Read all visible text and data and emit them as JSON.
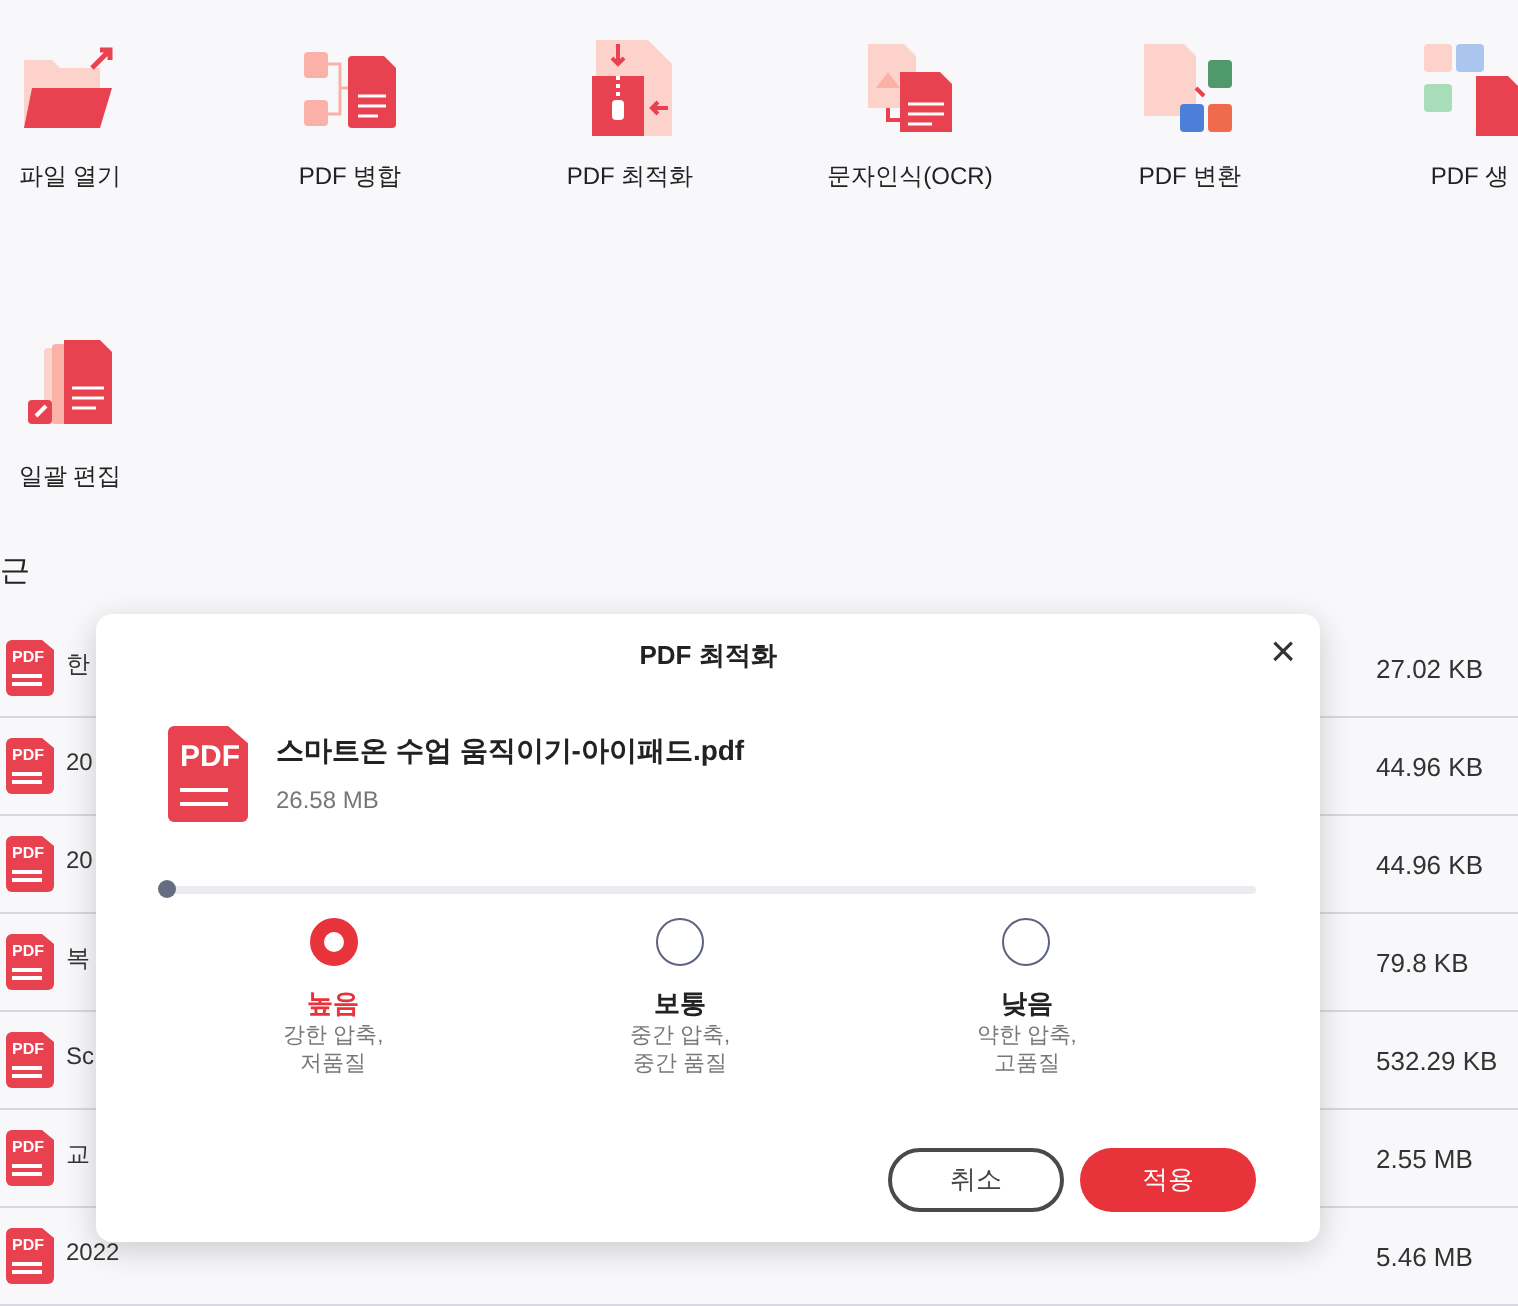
{
  "tools": [
    {
      "label": "파일 열기",
      "kind": "open"
    },
    {
      "label": "PDF 병합",
      "kind": "merge"
    },
    {
      "label": "PDF 최적화",
      "kind": "compress"
    },
    {
      "label": "문자인식(OCR)",
      "kind": "ocr"
    },
    {
      "label": "PDF 변환",
      "kind": "convert"
    },
    {
      "label": "PDF 생",
      "kind": "create"
    },
    {
      "label": "일괄 편집",
      "kind": "batch"
    }
  ],
  "section": {
    "title": "근"
  },
  "files": [
    {
      "icon_label": "PDF",
      "name": "한",
      "size": "27.02 KB"
    },
    {
      "icon_label": "PDF",
      "name": "20",
      "size": "44.96 KB"
    },
    {
      "icon_label": "PDF",
      "name": "20",
      "size": "44.96 KB"
    },
    {
      "icon_label": "PDF",
      "name": "복",
      "size": "79.8 KB"
    },
    {
      "icon_label": "PDF",
      "name": "Sc",
      "size": "532.29 KB"
    },
    {
      "icon_label": "PDF",
      "name": "교",
      "size": "2.55 MB"
    },
    {
      "icon_label": "PDF",
      "name": "2022",
      "size": "5.46 MB"
    }
  ],
  "dialog": {
    "title": "PDF 최적화",
    "close": "×",
    "file": {
      "icon_label": "PDF",
      "name": "스마트온 수업 움직이기-아이패드.pdf",
      "size": "26.58 MB"
    },
    "slider": {
      "level": 0
    },
    "options": [
      {
        "label": "높음",
        "description": "강한 압축,\n저품질",
        "selected": true
      },
      {
        "label": "보통",
        "description": "중간 압축,\n중간 품질",
        "selected": false
      },
      {
        "label": "낮음",
        "description": "약한 압축,\n고품질",
        "selected": false
      }
    ],
    "buttons": [
      {
        "label": "취소",
        "kind": "secondary"
      },
      {
        "label": "적용",
        "kind": "primary"
      }
    ]
  }
}
